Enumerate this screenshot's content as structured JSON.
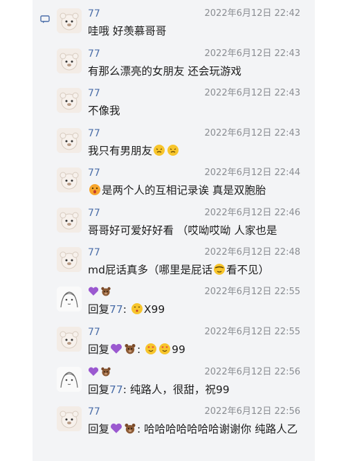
{
  "messages": [
    {
      "name": "77",
      "time": "2022年6月12日 22:42",
      "text": "哇哦 好羡慕哥哥"
    },
    {
      "name": "77",
      "time": "2022年6月12日 22:43",
      "text": "有那么漂亮的女朋友 还会玩游戏"
    },
    {
      "name": "77",
      "time": "2022年6月12日 22:43",
      "text": "不像我"
    },
    {
      "name": "77",
      "time": "2022年6月12日 22:43",
      "text": "我只有男朋友"
    },
    {
      "name": "77",
      "time": "2022年6月12日 22:44",
      "text": "是两个人的互相记录诶 真是双胞胎"
    },
    {
      "name": "77",
      "time": "2022年6月12日 22:46",
      "text": "哥哥好可爱好好看 （哎呦哎呦 人家也是"
    },
    {
      "name": "77",
      "time": "2022年6月12日 22:48",
      "text_a": "md屁话真多（哪里是屁话",
      "text_b": "看不见）"
    },
    {
      "name": "",
      "time": "2022年6月12日 22:55",
      "reply_prefix": "回复",
      "mention": "77",
      "colon": ": ",
      "text": "X99"
    },
    {
      "name": "77",
      "time": "2022年6月12日 22:55",
      "reply_prefix": "回复",
      "colon": ": ",
      "text": "99"
    },
    {
      "name": "",
      "time": "2022年6月12日 22:56",
      "reply_prefix": "回复",
      "mention": "77",
      "text": ": 纯路人，很甜，祝99"
    },
    {
      "name": "77",
      "time": "2022年6月12日 22:56",
      "reply_prefix": "回复",
      "text": ": 哈哈哈哈哈哈哈谢谢你 纯路人乙"
    }
  ],
  "colors": {
    "panel": "#f3f4f6",
    "name": "#4a6da8",
    "time": "#8a8d92",
    "text": "#1c1c1c"
  }
}
